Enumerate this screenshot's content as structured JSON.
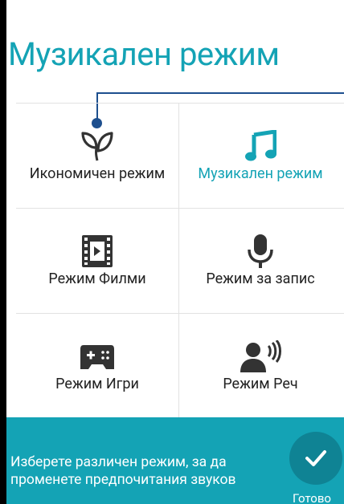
{
  "title": "Музикален режим",
  "modes": [
    {
      "label": "Икономичен режим",
      "icon": "leaf-icon",
      "active": false
    },
    {
      "label": "Музикален режим",
      "icon": "music-note-icon",
      "active": true
    },
    {
      "label": "Режим Филми",
      "icon": "film-icon",
      "active": false
    },
    {
      "label": "Режим за запис",
      "icon": "microphone-icon",
      "active": false
    },
    {
      "label": "Режим Игри",
      "icon": "gamepad-icon",
      "active": false
    },
    {
      "label": "Режим Реч",
      "icon": "speaker-voice-icon",
      "active": false
    }
  ],
  "footer": {
    "hint": "Изберете различен режим, за да променете предпочитания звуков",
    "done_label": "Готово"
  },
  "colors": {
    "accent": "#14a3b5",
    "guide": "#1d4f8e",
    "footer_button": "#0f8394"
  }
}
